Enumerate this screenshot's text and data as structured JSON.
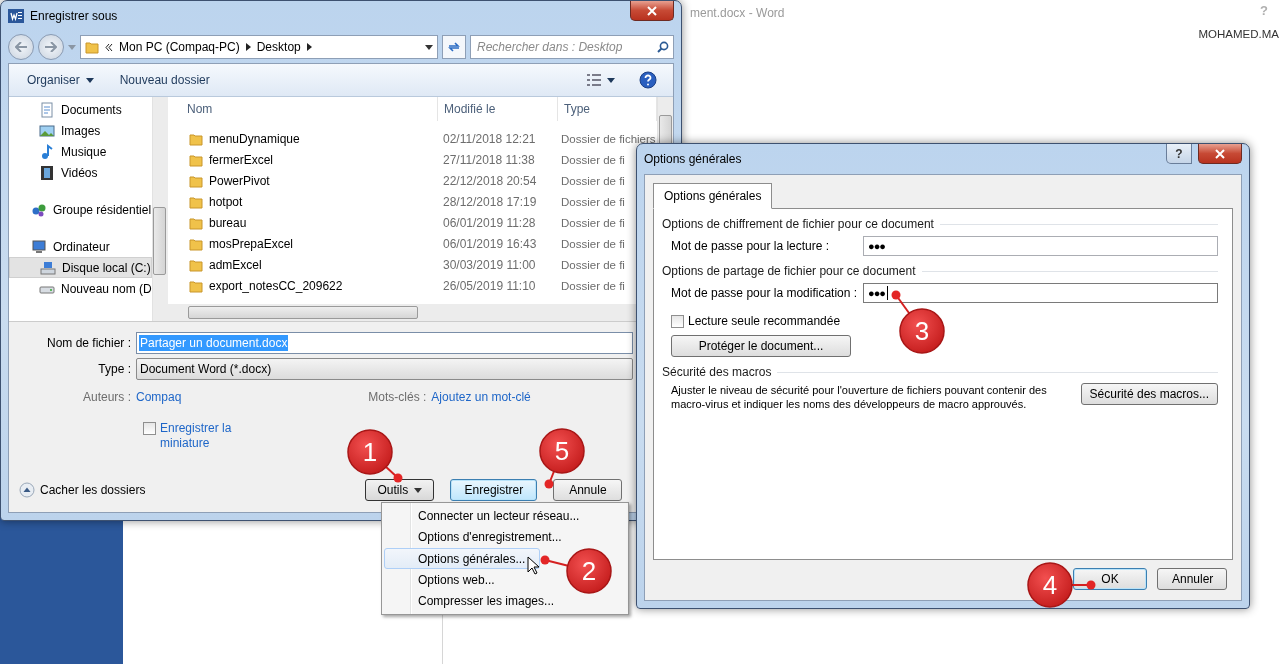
{
  "word": {
    "title": "ment.docx - Word",
    "help": "?",
    "user": "MOHAMED.MA"
  },
  "save_dialog": {
    "title": "Enregistrer sous",
    "address": {
      "path": [
        "Mon PC (Compaq-PC)",
        "Desktop"
      ]
    },
    "search": {
      "placeholder": "Rechercher dans : Desktop"
    },
    "toolbar": [
      {
        "label": "Organiser",
        "kind": "menu"
      },
      {
        "label": "Nouveau dossier",
        "kind": "plain"
      }
    ],
    "nav": [
      {
        "items": [
          {
            "label": "Documents",
            "kind": "documents",
            "selected": false
          },
          {
            "label": "Images",
            "kind": "images",
            "selected": false
          },
          {
            "label": "Musique",
            "kind": "music",
            "selected": false
          },
          {
            "label": "Vidéos",
            "kind": "videos",
            "selected": false
          }
        ]
      },
      {
        "items": [
          {
            "label": "Groupe résidentiel",
            "kind": "homegroup",
            "selected": false
          }
        ]
      },
      {
        "items": [
          {
            "label": "Ordinateur",
            "kind": "computer",
            "selected": false,
            "children": [
              {
                "label": "Disque local (C:)",
                "kind": "drive",
                "selected": true
              },
              {
                "label": "Nouveau nom (D",
                "kind": "disk",
                "selected": false
              }
            ]
          }
        ]
      }
    ],
    "columns": [
      "Nom",
      "Modifié le",
      "Type"
    ],
    "files": [
      {
        "name": "menuDynamique",
        "modified": "02/11/2018 12:21",
        "type": "Dossier de fichiers"
      },
      {
        "name": "fermerExcel",
        "modified": "27/11/2018 11:38",
        "type": "Dossier de fi"
      },
      {
        "name": "PowerPivot",
        "modified": "22/12/2018 20:54",
        "type": "Dossier de fi"
      },
      {
        "name": "hotpot",
        "modified": "28/12/2018 17:19",
        "type": "Dossier de fi"
      },
      {
        "name": "bureau",
        "modified": "06/01/2019 11:28",
        "type": "Dossier de fi"
      },
      {
        "name": "mosPrepaExcel",
        "modified": "06/01/2019 16:43",
        "type": "Dossier de fi"
      },
      {
        "name": "admExcel",
        "modified": "30/03/2019 11:00",
        "type": "Dossier de fi"
      },
      {
        "name": "export_notesCC_209622",
        "modified": "26/05/2019 11:10",
        "type": "Dossier de fi"
      }
    ],
    "filename": {
      "label": "Nom de fichier :",
      "value": "Partager un document.docx"
    },
    "filetype": {
      "label": "Type :",
      "value": "Document Word (*.docx)"
    },
    "authors": {
      "label": "Auteurs :",
      "value": "Compaq"
    },
    "keywords": {
      "label": "Mots-clés :",
      "value": "Ajoutez un mot-clé"
    },
    "thumbnail": {
      "label": "Enregistrer la miniature",
      "checked": false
    },
    "hide_folders": "Cacher les dossiers",
    "buttons": [
      {
        "label": "Outils",
        "kind": "menu"
      },
      {
        "label": "Enregistrer",
        "kind": "default"
      },
      {
        "label": "Annule",
        "kind": "plain"
      }
    ]
  },
  "tools_menu": [
    {
      "label": "Connecter un lecteur réseau...",
      "selected": false
    },
    {
      "label": "Options d'enregistrement...",
      "selected": false
    },
    {
      "label": "Options générales...",
      "selected": true
    },
    {
      "label": "Options web...",
      "selected": false
    },
    {
      "label": "Compresser les images...",
      "selected": false
    }
  ],
  "options_dialog": {
    "title": "Options générales",
    "help": "?",
    "tabs": [
      {
        "label": "Options générales",
        "selected": true
      }
    ],
    "sections": [
      {
        "title": "Options de chiffrement de fichier pour ce document",
        "rows": [
          {
            "kind": "password",
            "label": "Mot de passe pour la lecture :",
            "value": "●●●",
            "focused": false
          }
        ]
      },
      {
        "title": "Options de partage de fichier pour ce document",
        "rows": [
          {
            "kind": "password",
            "label": "Mot de passe pour la modification :",
            "value": "●●●",
            "focused": true
          },
          {
            "kind": "checkbox",
            "label": "Lecture seule recommandée",
            "checked": false
          },
          {
            "kind": "button",
            "label": "Protéger le document..."
          }
        ]
      },
      {
        "title": "Sécurité des macros",
        "rows": [
          {
            "kind": "text_button",
            "text": "Ajuster le niveau de sécurité pour l'ouverture de fichiers pouvant contenir des macro-virus et indiquer les noms des développeurs de macro approuvés.",
            "label": "Sécurité des macros..."
          }
        ]
      }
    ],
    "buttons": [
      {
        "label": "OK",
        "kind": "default"
      },
      {
        "label": "Annuler",
        "kind": "plain"
      }
    ]
  },
  "callouts": [
    "1",
    "2",
    "3",
    "4",
    "5"
  ]
}
